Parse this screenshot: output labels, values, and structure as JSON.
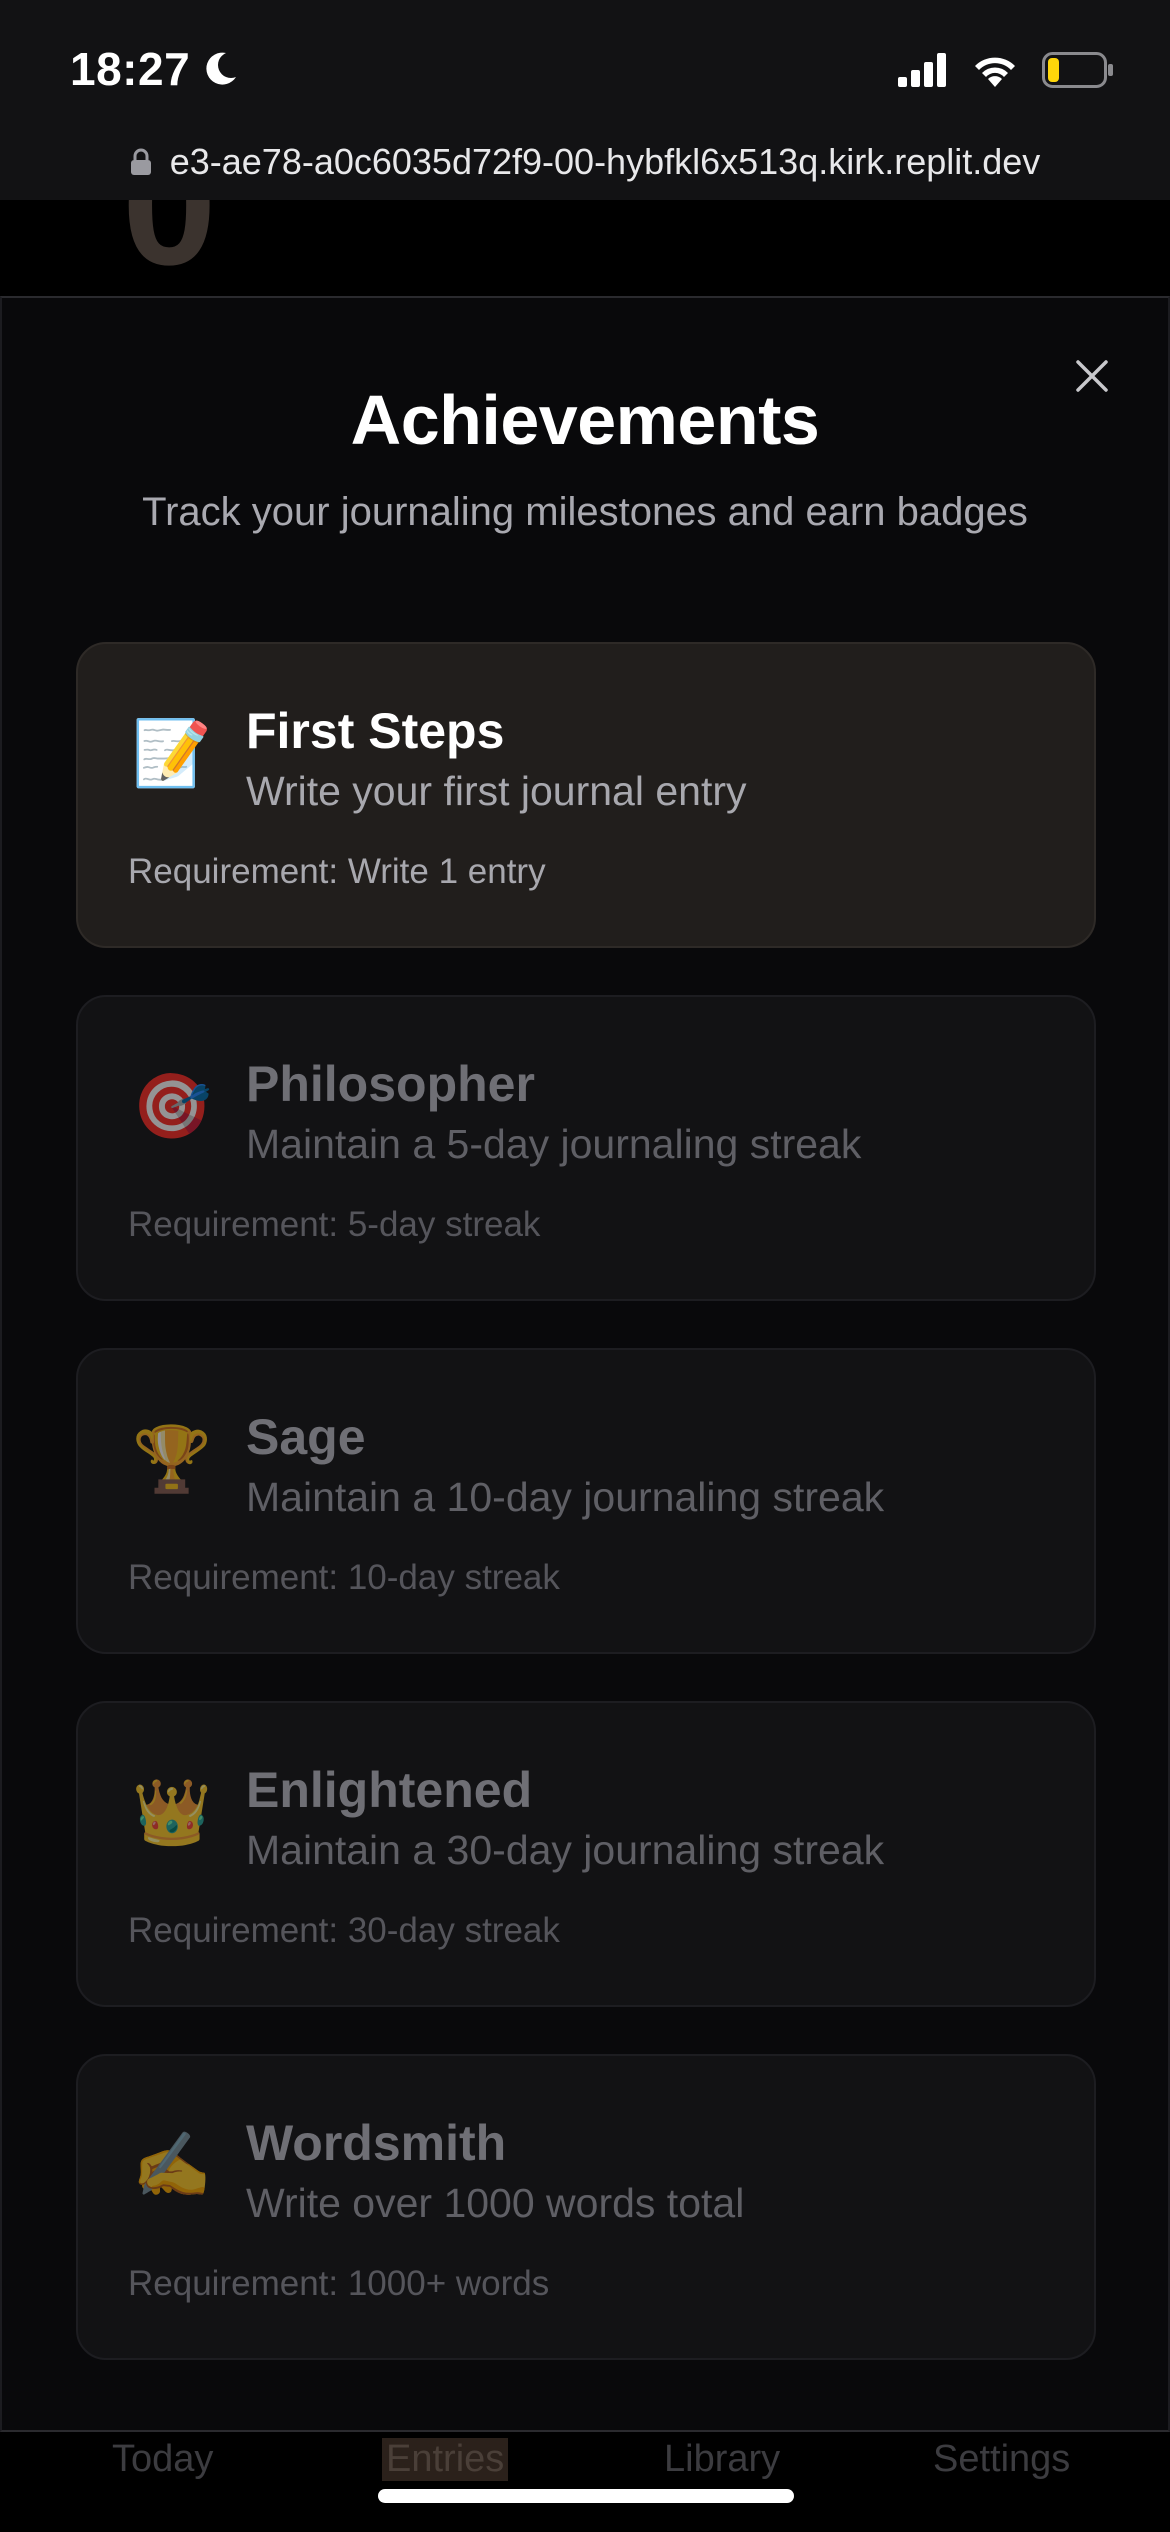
{
  "status_bar": {
    "time": "18:27",
    "icons": [
      "moon-icon",
      "signal-icon",
      "wifi-icon",
      "battery-icon"
    ]
  },
  "browser": {
    "url": "e3-ae78-a0c6035d72f9-00-hybfkl6x513q.kirk.replit.dev"
  },
  "modal": {
    "title": "Achievements",
    "subtitle": "Track your journaling milestones and earn badges",
    "achievements": [
      {
        "emoji": "📝",
        "icon": "memo-icon",
        "title": "First Steps",
        "description": "Write your first journal entry",
        "requirement": "Requirement: Write 1 entry",
        "unlocked": true
      },
      {
        "emoji": "🎯",
        "icon": "target-icon",
        "title": "Philosopher",
        "description": "Maintain a 5-day journaling streak",
        "requirement": "Requirement: 5-day streak",
        "unlocked": false
      },
      {
        "emoji": "🏆",
        "icon": "trophy-icon",
        "title": "Sage",
        "description": "Maintain a 10-day journaling streak",
        "requirement": "Requirement: 10-day streak",
        "unlocked": false
      },
      {
        "emoji": "👑",
        "icon": "crown-icon",
        "title": "Enlightened",
        "description": "Maintain a 30-day journaling streak",
        "requirement": "Requirement: 30-day streak",
        "unlocked": false
      },
      {
        "emoji": "✍️",
        "icon": "writing-hand-icon",
        "title": "Wordsmith",
        "description": "Write over 1000 words total",
        "requirement": "Requirement: 1000+ words",
        "unlocked": false
      }
    ]
  },
  "tab_bar": {
    "tabs": [
      {
        "label": "Today",
        "active": false
      },
      {
        "label": "Entries",
        "active": true
      },
      {
        "label": "Library",
        "active": false
      },
      {
        "label": "Settings",
        "active": false
      }
    ]
  },
  "colors": {
    "modal_background": "#09090b",
    "unlocked_card": "#211e1c",
    "locked_card": "#121214",
    "accent_tab": "#2b211b"
  }
}
